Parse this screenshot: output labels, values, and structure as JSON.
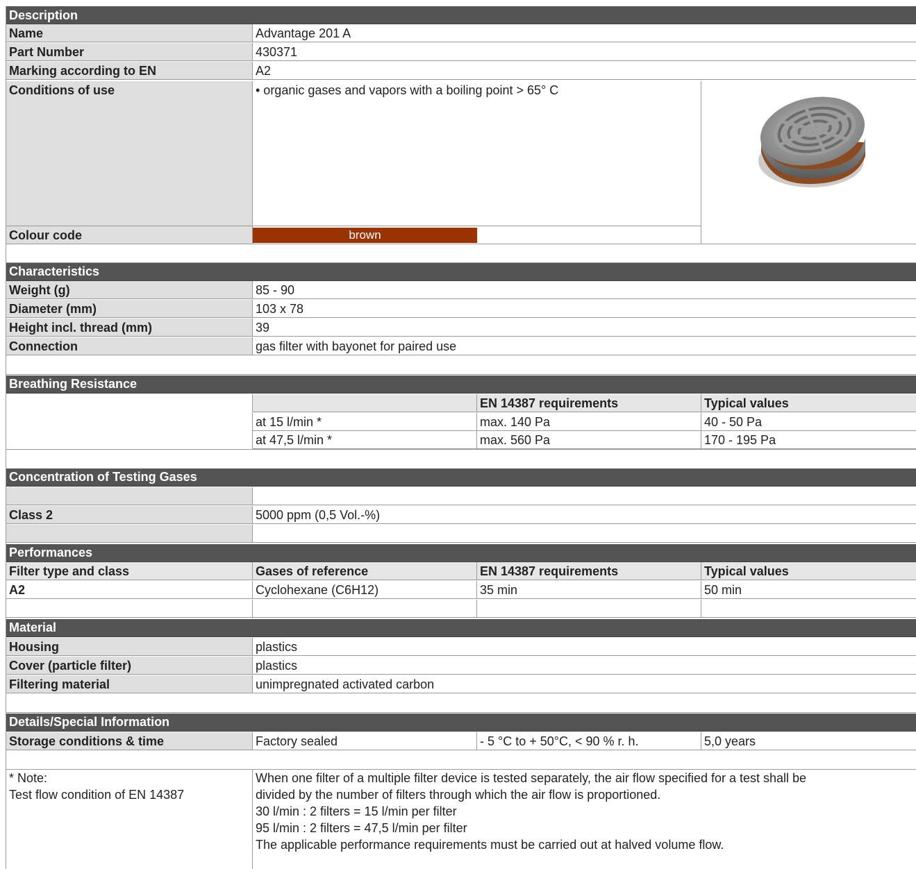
{
  "description": {
    "header": "Description",
    "rows": [
      {
        "label": "Name",
        "value": "Advantage 201 A"
      },
      {
        "label": "Part Number",
        "value": "430371"
      },
      {
        "label": "Marking according to EN",
        "value": "A2"
      },
      {
        "label": "Conditions of use",
        "value": "• organic gases and vapors with a boiling  point > 65° C"
      },
      {
        "label": "Colour code",
        "value": "brown"
      }
    ],
    "colour_code_color": "#993300",
    "product_image": "gas-filter-cartridge-photo"
  },
  "characteristics": {
    "header": "Characteristics",
    "rows": [
      {
        "label": "Weight (g)",
        "value": "85 - 90"
      },
      {
        "label": "Diameter (mm)",
        "value": "103 x 78"
      },
      {
        "label": "Height incl. thread (mm)",
        "value": "39"
      },
      {
        "label": "Connection",
        "value": "gas filter with bayonet for paired use"
      }
    ]
  },
  "breathing": {
    "header": "Breathing Resistance",
    "columns": [
      "",
      "EN 14387 requirements",
      "Typical values"
    ],
    "rows": [
      {
        "condition": "at 15 l/min *",
        "requirement": "max. 140 Pa",
        "typical": "40 - 50 Pa"
      },
      {
        "condition": "at 47,5 l/min *",
        "requirement": "max. 560 Pa",
        "typical": "170 - 195 Pa"
      }
    ]
  },
  "concentration": {
    "header": "Concentration of Testing Gases",
    "rows": [
      {
        "label": "Class 2",
        "value": "5000 ppm (0,5 Vol.-%)"
      }
    ]
  },
  "performances": {
    "header": "Performances",
    "columns": [
      "Filter type and class",
      "Gases of reference",
      "EN 14387 requirements",
      "Typical values"
    ],
    "rows": [
      {
        "cls": "A2",
        "gas": "Cyclohexane (C6H12)",
        "requirement": "35 min",
        "typical": "50 min"
      }
    ]
  },
  "material": {
    "header": "Material",
    "rows": [
      {
        "label": "Housing",
        "value": "plastics"
      },
      {
        "label": "Cover (particle filter)",
        "value": "plastics"
      },
      {
        "label": "Filtering material",
        "value": "unimpregnated activated carbon"
      }
    ]
  },
  "details": {
    "header": "Details/Special Information",
    "row": {
      "label": "Storage conditions & time",
      "condition": "Factory sealed",
      "range": "- 5 °C to + 50°C, < 90 % r. h.",
      "time": "5,0 years"
    }
  },
  "note": {
    "title": "* Note:",
    "subtitle": "Test flow condition of EN 14387",
    "lines": [
      "When one filter of a multiple filter device is tested separately, the air flow specified for a test shall be",
      "divided by the number of filters through which the air flow is proportioned.",
      "30 l/min : 2 filters = 15 l/min per filter",
      "95 l/min : 2 filters = 47,5 l/min per filter",
      "The applicable performance requirements must be carried out at halved volume flow."
    ]
  }
}
